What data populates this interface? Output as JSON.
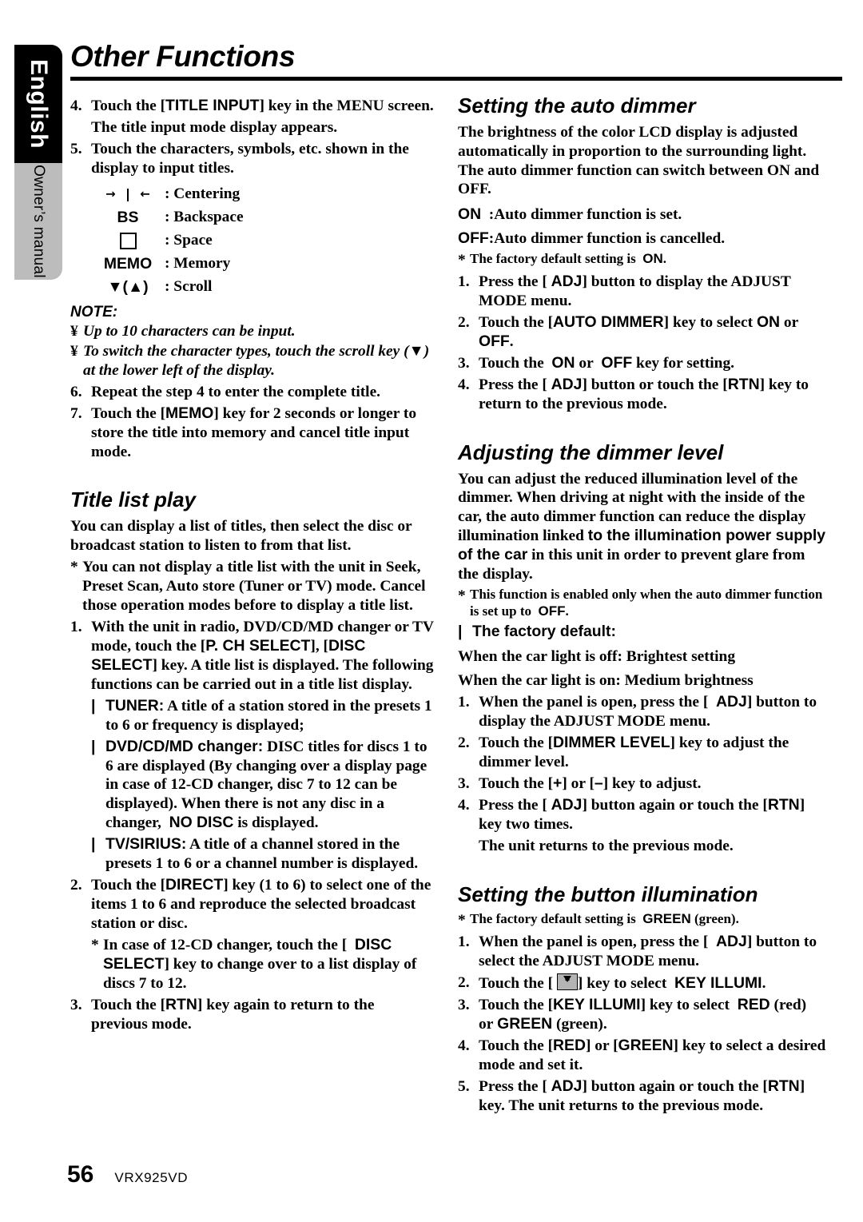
{
  "side_tabs": {
    "language": "English",
    "manual": "Owner’s manual"
  },
  "header": {
    "title": "Other Functions"
  },
  "footer": {
    "page_number": "56",
    "model": "VRX925VD"
  },
  "left_column": {
    "step4": {
      "num": "4.",
      "text_a": "Touch the [",
      "key": "TITLE INPUT",
      "text_b": "] key in the MENU screen.",
      "follow": "The title input mode display appears."
    },
    "step5": {
      "num": "5.",
      "text": "Touch the characters, symbols, etc. shown in the display to input titles."
    },
    "symbols": [
      {
        "icon": "centering-icon",
        "key": "",
        "value": ": Centering"
      },
      {
        "icon": "",
        "key": "BS",
        "value": ": Backspace"
      },
      {
        "icon": "square-icon",
        "key": "",
        "value": ": Space"
      },
      {
        "icon": "",
        "key": "MEMO",
        "value": ": Memory"
      },
      {
        "icon": "",
        "key": "▼(▲)",
        "value": ": Scroll"
      }
    ],
    "note": {
      "label": "NOTE:",
      "items": [
        "Up to 10 characters can be input.",
        "To switch the character types, touch the scroll key (▼) at the lower left of the display."
      ],
      "marker": "¥"
    },
    "step6": {
      "num": "6.",
      "text": "Repeat the step 4 to enter the complete title."
    },
    "step7": {
      "num": "7.",
      "text_a": "Touch the [",
      "key": "MEMO",
      "text_b": "] key for 2 seconds or longer to store the title into memory and cancel title input mode."
    },
    "title_list_play": {
      "heading": "Title list play",
      "intro": "You can display a list of titles, then select the disc or broadcast station to listen to from that list.",
      "note_star": "You can not display a title list with the unit in Seek, Preset Scan, Auto store (Tuner or TV) mode. Cancel those operation modes before to display a title list.",
      "step1": {
        "num": "1.",
        "text_a": "With the unit in radio, DVD/CD/MD changer or TV mode, touch the [",
        "key1": "P. CH SELECT",
        "text_b": "], [",
        "key2": "DISC SELECT",
        "text_c": "] key. A title list is displayed. The following functions can be carried out in a title list display."
      },
      "bullets": [
        {
          "label": "TUNER:",
          "text": " A title of a station stored in the presets 1 to 6 or frequency is displayed;"
        },
        {
          "label": "DVD/CD/MD changer:",
          "text_a": " DISC titles for discs 1 to 6 are displayed (By changing over a display page in case of 12-CD changer, disc 7 to 12 can be displayed). When there is not any disc in a changer,",
          "key": "NO DISC",
          "text_b": "is displayed."
        },
        {
          "label": "TV/SIRIUS:",
          "text": " A title of a channel stored in the presets 1 to 6 or a channel number is displayed."
        }
      ],
      "step2": {
        "num": "2.",
        "text_a": "Touch the [",
        "key": "DIRECT",
        "text_b": "] key (1 to 6) to select one of the items 1 to 6 and reproduce the selected broadcast station or disc.",
        "star_a": "In case of 12-CD changer, touch the [",
        "star_key": "DISC SELECT",
        "star_b": "] key to change over to a list display of discs 7 to 12."
      },
      "step3": {
        "num": "3.",
        "text_a": "Touch the [",
        "key": "RTN",
        "text_b": "] key again to return to the previous mode."
      }
    }
  },
  "right_column": {
    "auto_dimmer": {
      "heading": "Setting the auto dimmer",
      "intro": "The brightness of the color LCD display is adjusted automatically in proportion to the surrounding light. The auto dimmer function can switch between ON and OFF.",
      "on_key": "ON",
      "on_text": ":Auto dimmer function is set.",
      "off_key": "OFF",
      "off_text": ":Auto dimmer function is cancelled.",
      "default_a": "The factory default setting is",
      "default_key": "ON",
      "default_b": ".",
      "step1": {
        "num": "1.",
        "text_a": "Press the [",
        "key": "ADJ",
        "text_b": "] button to display the ADJUST MODE menu."
      },
      "step2": {
        "num": "2.",
        "text_a": "Touch the [",
        "key": "AUTO DIMMER",
        "text_b": "] key to select",
        "key_on": "ON",
        "mid": "or",
        "key_off": "OFF",
        "text_c": "."
      },
      "step3": {
        "num": "3.",
        "text_a": "Touch the",
        "key_on": "ON",
        "mid": "or",
        "key_off": "OFF",
        "text_b": "key for setting."
      },
      "step4": {
        "num": "4.",
        "text_a": "Press the [",
        "key1": "ADJ",
        "text_b": "] button or touch the [",
        "key2": "RTN",
        "text_c": "] key to return to the previous mode."
      }
    },
    "dimmer_level": {
      "heading": "Adjusting the dimmer level",
      "intro_a": "You can adjust the reduced illumination level of the dimmer. When driving at night with the inside of the car, the auto dimmer function can reduce the display illumination linked",
      "intro_sans": "to the illumination power supply of the car",
      "intro_b": "in this unit in order to prevent glare from the display.",
      "star_a": "This function is enabled only when the auto dimmer function is set up to",
      "star_key": "OFF",
      "star_b": ".",
      "factory_default": "The factory default:",
      "default_off": "When the car light is off: Brightest setting",
      "default_on": "When the car light is on: Medium brightness",
      "step1": {
        "num": "1.",
        "text_a": "When the panel is open, press the [",
        "key": "ADJ",
        "text_b": "] button to display the ADJUST MODE menu."
      },
      "step2": {
        "num": "2.",
        "text_a": "Touch the [",
        "key": "DIMMER LEVEL",
        "text_b": "] key to adjust the dimmer level."
      },
      "step3": {
        "num": "3.",
        "text_a": "Touch the [",
        "key_plus": "+",
        "mid": "] or [",
        "key_minus": "–",
        "text_b": "] key to adjust."
      },
      "step4": {
        "num": "4.",
        "text_a": "Press the [",
        "key1": "ADJ",
        "text_b": "] button again or touch the [",
        "key2": "RTN",
        "text_c": "] key two times.",
        "follow": "The unit returns to the previous mode."
      }
    },
    "button_illumination": {
      "heading": "Setting the button illumination",
      "default_a": "The factory default setting is",
      "default_key": "GREEN",
      "default_b": "(green).",
      "step1": {
        "num": "1.",
        "text_a": "When the panel is open, press the [",
        "key": "ADJ",
        "text_b": "] button to select the ADJUST MODE menu."
      },
      "step2": {
        "num": "2.",
        "text_a": "Touch the [",
        "icon": "down-arrow-key-icon",
        "text_b": "] key to select",
        "key": "KEY ILLUMI",
        "text_c": "."
      },
      "step3": {
        "num": "3.",
        "text_a": "Touch the [",
        "key1": "KEY ILLUMI",
        "text_b": "] key to select",
        "key_red": "RED",
        "text_c": "(red) or",
        "key_green": "GREEN",
        "text_d": "(green)."
      },
      "step4": {
        "num": "4.",
        "text_a": "Touch the [",
        "key1": "RED",
        "text_b": "] or [",
        "key2": "GREEN",
        "text_c": "] key to select a desired mode and set it."
      },
      "step5": {
        "num": "5.",
        "text_a": "Press the [",
        "key1": "ADJ",
        "text_b": "] button again or touch the [",
        "key2": "RTN",
        "text_c": "] key. The unit returns to the previous mode."
      }
    }
  }
}
